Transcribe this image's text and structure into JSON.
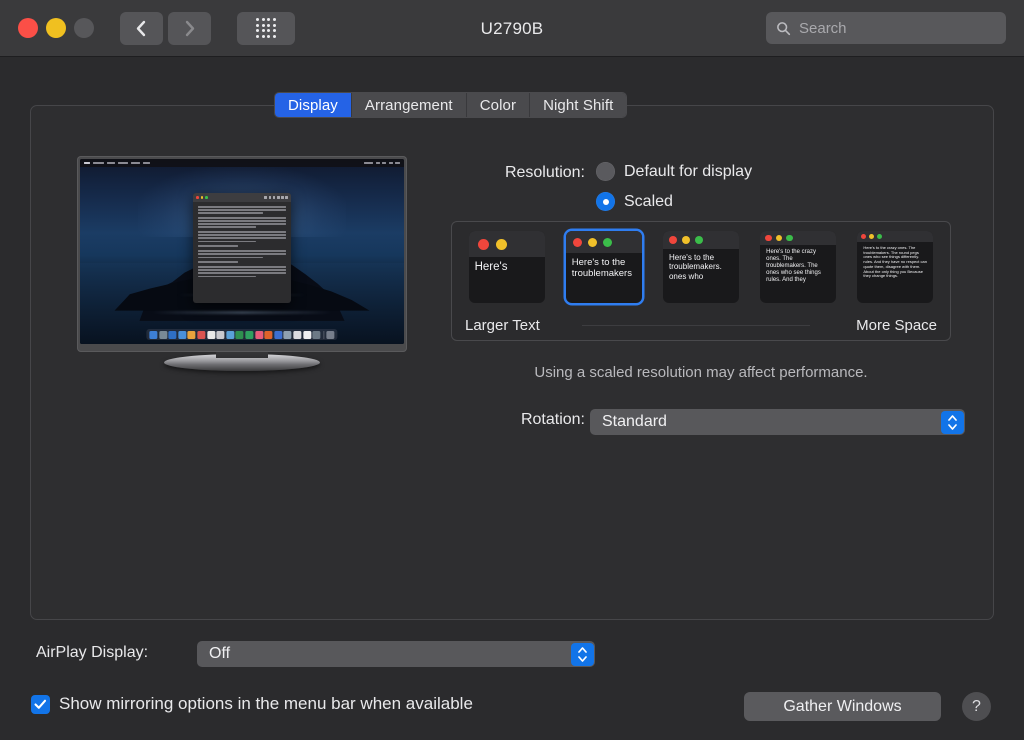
{
  "window": {
    "title": "U2790B",
    "traffic_lights": [
      "close",
      "minimize",
      "zoom"
    ],
    "back_label": "Back",
    "forward_label": "Forward",
    "grid_label": "Show All",
    "search": {
      "placeholder": "Search",
      "value": ""
    }
  },
  "tabs": [
    {
      "label": "Display",
      "active": true
    },
    {
      "label": "Arrangement",
      "active": false
    },
    {
      "label": "Color",
      "active": false
    },
    {
      "label": "Night Shift",
      "active": false
    }
  ],
  "resolution": {
    "label": "Resolution:",
    "options": [
      {
        "label": "Default for display",
        "selected": false
      },
      {
        "label": "Scaled",
        "selected": true
      }
    ],
    "scaled_thumbnails": [
      {
        "index": 1,
        "selected": false,
        "dots": [
          "#f0463c",
          "#f0c02a"
        ],
        "text": "Here's",
        "font_size": 11.5
      },
      {
        "index": 2,
        "selected": true,
        "dots": [
          "#f0463c",
          "#f0c02a",
          "#3bbd4a"
        ],
        "text": "Here's to the troublemakers",
        "font_size": 9.5
      },
      {
        "index": 3,
        "selected": false,
        "dots": [
          "#f0463c",
          "#f0c02a",
          "#3bbd4a"
        ],
        "text": "Here's to the troublemakers. ones who",
        "font_size": 8
      },
      {
        "index": 4,
        "selected": false,
        "dots": [
          "#f0463c",
          "#f0c02a",
          "#3bbd4a"
        ],
        "text": "Here's to the crazy ones. The troublemakers. The ones who see things rules. And they",
        "font_size": 6
      },
      {
        "index": 5,
        "selected": false,
        "dots": [
          "#f0463c",
          "#f0c02a",
          "#3bbd4a"
        ],
        "text": "Here's to the crazy ones. The troublemakers. The round pegs ones who see things differently. rules. And they have no respect can quote them, disagree with them. About the only thing you Because they change things.",
        "font_size": 4
      }
    ],
    "scale_left_label": "Larger Text",
    "scale_right_label": "More Space",
    "hint": "Using a scaled resolution may affect performance."
  },
  "rotation": {
    "label": "Rotation:",
    "value": "Standard"
  },
  "airplay": {
    "label": "AirPlay Display:",
    "value": "Off"
  },
  "mirroring": {
    "label": "Show mirroring options in the menu bar when available",
    "checked": true
  },
  "buttons": {
    "gather_windows": "Gather Windows",
    "help": "?"
  },
  "preview": {
    "menubar_left_items": [
      6,
      11,
      8,
      10,
      9,
      7
    ],
    "menubar_right_items": [
      9,
      4,
      4,
      4,
      5
    ],
    "window_paragraph_lines": [
      3,
      4,
      4,
      1,
      3,
      1,
      4
    ],
    "dock_icons": [
      "#3d7fd6",
      "#7a8a96",
      "#2f6fc4",
      "#4a90d9",
      "#e8a33d",
      "#d9534f",
      "#e8e8e8",
      "#c9c9cf",
      "#5aa0d8",
      "#2f8f4f",
      "#2fa05f",
      "#e85c7a",
      "#e0632a",
      "#3d6fd0",
      "#8fa0b0",
      "#dcdce0",
      "#f0f0f2",
      "#6d7a86"
    ]
  }
}
